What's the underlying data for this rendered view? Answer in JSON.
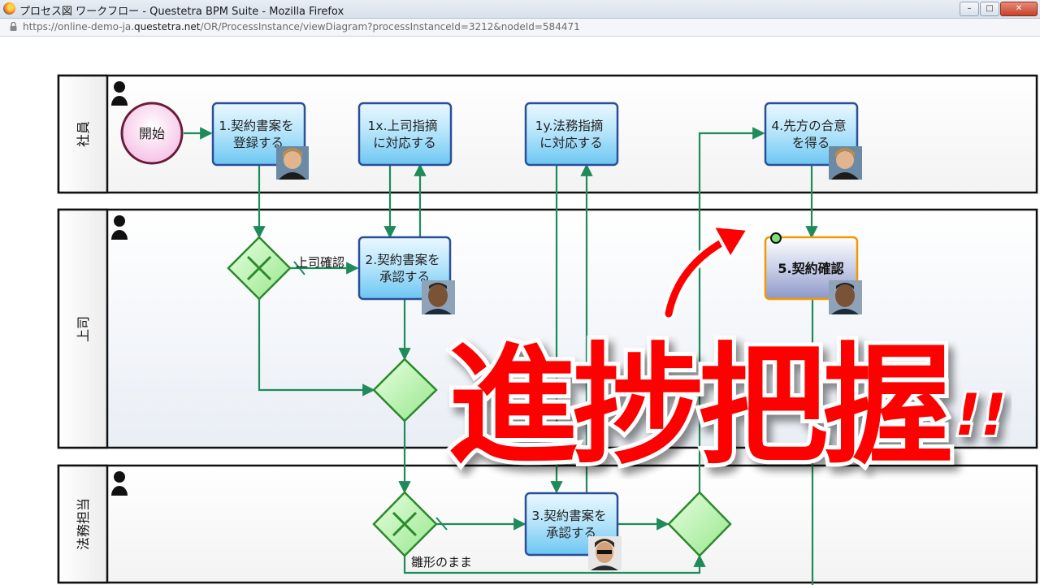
{
  "window": {
    "title": "プロセス図 ワークフロー - Questetra BPM Suite - Mozilla Firefox",
    "controls": [
      "minimize",
      "maximize",
      "close"
    ]
  },
  "address_bar": {
    "url_prefix": "https://online-demo-ja.",
    "url_domain": "questetra.net",
    "url_path": "/OR/ProcessInstance/viewDiagram?processInstanceId=3212&nodeId=584471"
  },
  "lanes": [
    {
      "name": "社員",
      "icon": "person-icon"
    },
    {
      "name": "上司",
      "icon": "person-icon"
    },
    {
      "name": "法務担当",
      "icon": "person-icon"
    }
  ],
  "nodes": {
    "start": "開始",
    "task1": [
      "1.契約書案を",
      "登録する"
    ],
    "task1x": [
      "1x.上司指摘",
      "に対応する"
    ],
    "task1y": [
      "1y.法務指摘",
      "に対応する"
    ],
    "task4": [
      "4.先方の合意",
      "を得る"
    ],
    "task2": [
      "2.契約書案を",
      "承認する"
    ],
    "task5": "5.契約確認",
    "task3": [
      "3.契約書案を",
      "承認する"
    ]
  },
  "flow_labels": {
    "boss_check": "上司確認",
    "draft_as_is": "雛形のまま"
  },
  "overlay": {
    "caption": "進捗把握",
    "exclaim": "!!",
    "accent_color": "#ff0000"
  },
  "colors": {
    "task_fill": "#9fdcf5",
    "task_border": "#2a4f9a",
    "flow": "#1f8a5a",
    "start_fill": "#fbd6ef",
    "start_border": "#7a2040",
    "gateway_fill": "#b8f0b0",
    "current_border": "#f09a00"
  }
}
